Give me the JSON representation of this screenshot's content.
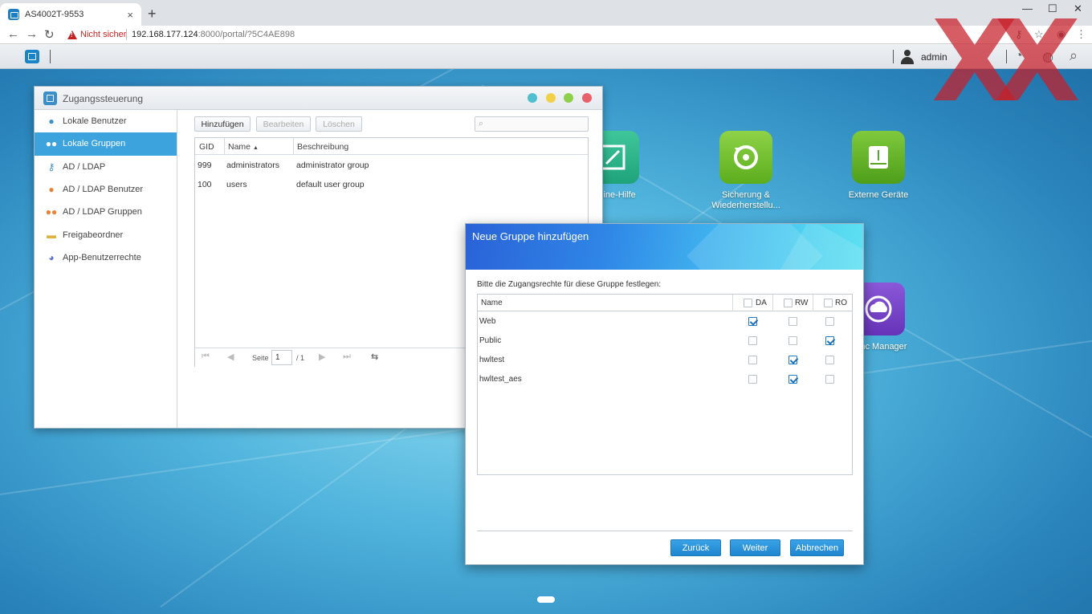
{
  "browser": {
    "tab_title": "AS4002T-9553",
    "tab_close": "×",
    "new_tab": "+",
    "not_secure": "Nicht sicher",
    "url_host": "192.168.177.124",
    "url_rest": ":8000/portal/?5C4AE898"
  },
  "taskbar": {
    "user": "admin"
  },
  "watermark": "XX",
  "desktop_apps": [
    {
      "label": "Online-Hilfe"
    },
    {
      "label": "Sicherung & Wiederherstellu..."
    },
    {
      "label": "Externe Geräte"
    },
    {
      "label": "Sync Manager"
    }
  ],
  "window": {
    "title": "Zugangssteuerung",
    "sidebar": [
      {
        "label": "Lokale Benutzer",
        "icon": "user-icon"
      },
      {
        "label": "Lokale Gruppen",
        "icon": "group-icon",
        "active": true
      },
      {
        "label": "AD / LDAP",
        "icon": "key-icon"
      },
      {
        "label": "AD / LDAP Benutzer",
        "icon": "ldap-user-icon"
      },
      {
        "label": "AD / LDAP Gruppen",
        "icon": "ldap-group-icon"
      },
      {
        "label": "Freigabeordner",
        "icon": "folder-icon"
      },
      {
        "label": "App-Benutzerrechte",
        "icon": "rocket-icon"
      }
    ],
    "toolbar": {
      "add": "Hinzufügen",
      "edit": "Bearbeiten",
      "delete": "Löschen"
    },
    "columns": {
      "gid": "GID",
      "name": "Name",
      "desc": "Beschreibung",
      "sort_indicator": "▲"
    },
    "rows": [
      {
        "gid": "999",
        "name": "administrators",
        "desc": "administrator group"
      },
      {
        "gid": "100",
        "name": "users",
        "desc": "default user group"
      }
    ],
    "pager": {
      "page_label": "Seite",
      "page": "1",
      "total": "/ 1"
    }
  },
  "dialog": {
    "title": "Neue Gruppe hinzufügen",
    "intro": "Bitte die Zugangsrechte für diese Gruppe festlegen:",
    "columns": {
      "name": "Name",
      "da": "DA",
      "rw": "RW",
      "ro": "RO"
    },
    "rows": [
      {
        "name": "Web",
        "da": true,
        "rw": false,
        "ro": false
      },
      {
        "name": "Public",
        "da": false,
        "rw": false,
        "ro": true
      },
      {
        "name": "hwltest",
        "da": false,
        "rw": true,
        "ro": false
      },
      {
        "name": "hwltest_aes",
        "da": false,
        "rw": true,
        "ro": false
      }
    ],
    "buttons": {
      "back": "Zurück",
      "next": "Weiter",
      "cancel": "Abbrechen"
    }
  }
}
